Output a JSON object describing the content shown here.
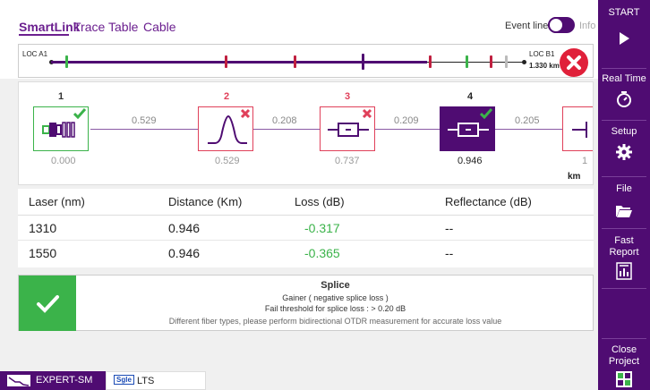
{
  "tabs": {
    "items": [
      {
        "label": "SmartLink",
        "active": true
      },
      {
        "label": "Trace",
        "active": false
      },
      {
        "label": "Table",
        "active": false
      },
      {
        "label": "Cable",
        "active": false
      }
    ],
    "event_line_label": "Event line",
    "event_line_enabled": true,
    "info_label": "Info"
  },
  "overview": {
    "loc_a": "LOC A1",
    "loc_b": "LOC B1",
    "length": "1.330 km",
    "status": "fail",
    "status_icon": "close-icon"
  },
  "events": [
    {
      "num": "1",
      "type": "connector",
      "status": "pass",
      "distance": "0.000",
      "num_color": "#333333"
    },
    {
      "num": "2",
      "type": "reflective",
      "status": "fail",
      "distance": "0.529",
      "num_color": "#e0405a"
    },
    {
      "num": "3",
      "type": "splice",
      "status": "fail",
      "distance": "0.737",
      "num_color": "#e0405a"
    },
    {
      "num": "4",
      "type": "splice",
      "status": "pass",
      "distance": "0.946",
      "num_color": "#222222",
      "selected": true
    },
    {
      "num": "",
      "type": "end",
      "status": "",
      "distance": "1",
      "num_color": "#333333"
    }
  ],
  "segments": [
    "0.529",
    "0.208",
    "0.209",
    "0.205"
  ],
  "units": "km",
  "table": {
    "headers": [
      "Laser (nm)",
      "Distance (Km)",
      "Loss (dB)",
      "Reflectance (dB)"
    ],
    "rows": [
      [
        "1310",
        "0.946",
        "-0.317",
        "--"
      ],
      [
        "1550",
        "0.946",
        "-0.365",
        "--"
      ]
    ]
  },
  "result": {
    "title": "Splice",
    "line1": "Gainer ( negative splice loss )",
    "line2": "Fail threshold for splice loss : > 0.20 dB",
    "line3": "Different fiber types, please perform bidirectional OTDR measurement for accurate loss value",
    "status": "pass"
  },
  "sidebar": {
    "start": "START",
    "realtime": "Real Time",
    "setup": "Setup",
    "file": "File",
    "fast_report_1": "Fast",
    "fast_report_2": "Report",
    "close_project_1": "Close",
    "close_project_2": "Project"
  },
  "bottombar": {
    "tab1": "EXPERT-SM",
    "tab2": "LTS",
    "tab2_badge": "Sgle"
  },
  "colors": {
    "brand": "#4f0c72",
    "pass": "#3bb34a",
    "fail": "#e0203a",
    "loss_value": "#3bb34a"
  }
}
